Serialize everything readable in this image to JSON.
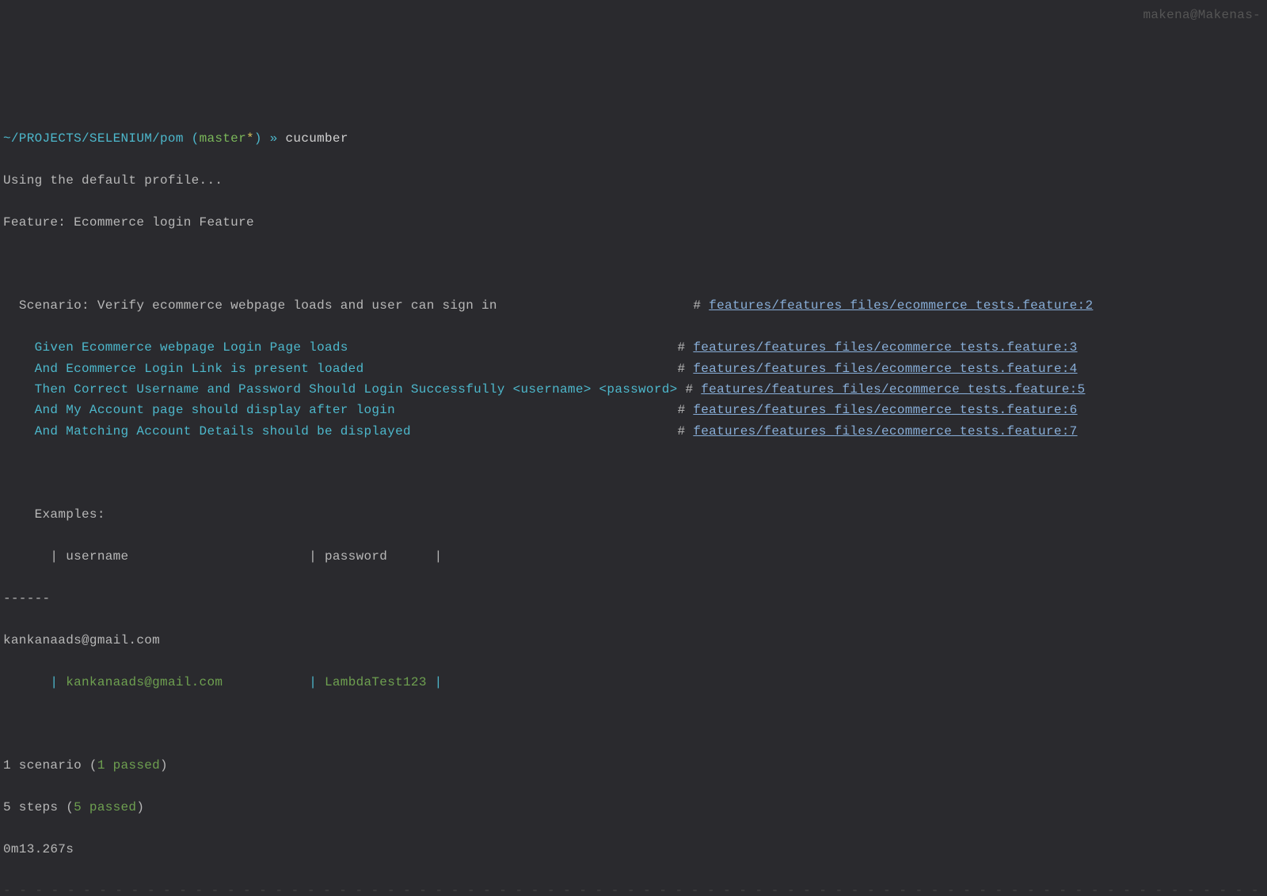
{
  "prompt": {
    "path": "~/PROJECTS/SELENIUM/pom",
    "branch_open": " (",
    "branch_name": "master",
    "branch_star": "*",
    "branch_close": ")",
    "arrow": " » ",
    "command": "cucumber"
  },
  "topright": "makena@Makenas-",
  "using": "Using the default profile...",
  "feature_line": "Feature: Ecommerce login Feature",
  "scenario": {
    "indent": "  ",
    "text": "Scenario: Verify ecommerce webpage loads and user can sign in",
    "pad": "                                                                                                                                                            ",
    "hash": "# ",
    "link": "features/features_files/ecommerce_tests.feature:2"
  },
  "steps": [
    {
      "indent": "    ",
      "text": "Given Ecommerce webpage Login Page loads",
      "hash": "# ",
      "link": "features/features_files/ecommerce_tests.feature:3"
    },
    {
      "indent": "    ",
      "text": "And Ecommerce Login Link is present loaded",
      "hash": "# ",
      "link": "features/features_files/ecommerce_tests.feature:4"
    },
    {
      "indent": "    ",
      "text": "Then Correct Username and Password Should Login Successfully <username> <password>",
      "hash": "# ",
      "link": "features/features_files/ecommerce_tests.feature:5"
    },
    {
      "indent": "    ",
      "text": "And My Account page should display after login",
      "hash": "# ",
      "link": "features/features_files/ecommerce_tests.feature:6"
    },
    {
      "indent": "    ",
      "text": "And Matching Account Details should be displayed",
      "hash": "# ",
      "link": "features/features_files/ecommerce_tests.feature:7"
    }
  ],
  "examples": {
    "indent": "    ",
    "label": "Examples:",
    "header_indent": "      ",
    "header": "| username                       | password      |"
  },
  "dashes": "------",
  "email_line": "kankanaads@gmail.com",
  "row": {
    "indent": "      ",
    "p1": "|",
    "user": " kankanaads@gmail.com           ",
    "p2": "|",
    "pass": " LambdaTest123 ",
    "p3": "|"
  },
  "summary": {
    "scenario_a": "1 scenario (",
    "scenario_b": "1 passed",
    "scenario_c": ")",
    "steps_a": "5 steps (",
    "steps_b": "5 passed",
    "steps_c": ")",
    "time": "0m13.267s"
  },
  "bottomdashes": "- - - - - - - - - - - - - - - - - - - - - - - - - - - - - - - - - - - - - - - - - - - - - - - - - - - - - - - - - - - - - - - - - - - - - - - - - - - - - - - - - - - - - - - - - - - - - - - - - -"
}
